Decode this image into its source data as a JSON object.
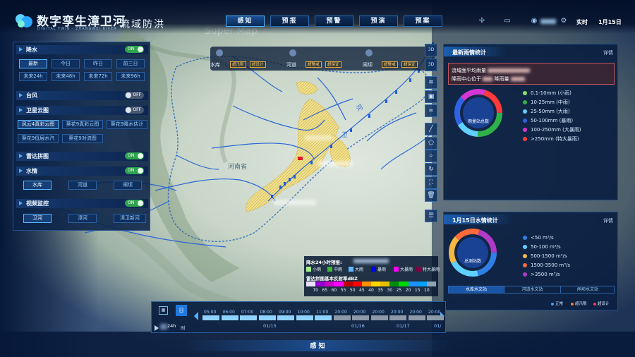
{
  "header": {
    "logo_title": "数字孪生漳卫河",
    "logo_subtitle": "DIGITAL TWIN · ZHANGWEI RIVER",
    "system_title": "流域防洪",
    "nav_tabs": [
      "感知",
      "预报",
      "预警",
      "预演",
      "预案"
    ],
    "active_tab": "感知",
    "realtime_label": "实时",
    "date": "1月15日"
  },
  "left_panel": {
    "rain": {
      "label": "降水",
      "toggle": "ON",
      "buttons_row1": [
        "最新",
        "今日",
        "昨日",
        "前三日"
      ],
      "buttons_row2": [
        "未来24h",
        "未来48h",
        "未来72h",
        "未来96h"
      ],
      "selected": "最新"
    },
    "typhoon": {
      "label": "台风",
      "toggle": "OFF"
    },
    "satellite": {
      "label": "卫星云图",
      "toggle": "OFF",
      "buttons_row1": [
        "风云4真彩云图",
        "葵花9真彩云图",
        "葵花9降水估计"
      ],
      "buttons_row2": [
        "葵花9低层水汽",
        "葵花9对流图"
      ],
      "selected": "风云4真彩云图"
    },
    "radar": {
      "label": "雷达拼图",
      "toggle": "ON"
    },
    "water": {
      "label": "水情",
      "toggle": "ON",
      "buttons": [
        "水库",
        "河道",
        "闸坝"
      ],
      "selected": "水库"
    },
    "video": {
      "label": "视频监控",
      "toggle": "ON",
      "buttons": [
        "卫河",
        "漳河",
        "漳卫新河"
      ],
      "selected": "卫河"
    }
  },
  "map": {
    "province_label": "河南省",
    "river_label_1": "河",
    "river_label_2": "卫",
    "legend_bar": {
      "groups": [
        {
          "name": "水库",
          "badges": [
            "超汛限",
            "超设计"
          ]
        },
        {
          "name": "河道",
          "badges": [
            "超警戒",
            "超保证"
          ]
        },
        {
          "name": "闸坝",
          "badges": [
            "超警戒",
            "超保证"
          ]
        }
      ]
    },
    "rain_legend": {
      "title": "降水24小时预报:",
      "items": [
        "小雨",
        "中雨",
        "大雨",
        "暴雨",
        "大暴雨",
        "特大暴雨"
      ],
      "item_colors": [
        "#a6f28f",
        "#3db83d",
        "#61b8ff",
        "#0000fe",
        "#fa00fa",
        "#800040"
      ],
      "radar_title": "雷达拼图基本反射率dBZ",
      "scale": [
        "70",
        "65",
        "60",
        "55",
        "50",
        "45",
        "40",
        "35",
        "30",
        "25",
        "20",
        "15",
        "10"
      ],
      "scale_colors": [
        "#e9e1ff",
        "#9400d3",
        "#c800c8",
        "#ff00ff",
        "#c00000",
        "#ff0000",
        "#ff9000",
        "#ffd800",
        "#e7c000",
        "#008e00",
        "#00d800",
        "#1e90ff",
        "#01a0f6",
        "#8fa3b6"
      ]
    }
  },
  "toolbar": {
    "icons": [
      "3D",
      "3D",
      "layers-icon",
      "image-icon",
      "link-icon",
      "ruler-icon",
      "polygon-icon",
      "search-icon",
      "refresh-icon",
      "fit-icon",
      "delete-icon",
      "list-icon"
    ]
  },
  "rain_stats": {
    "title": "最新雨情统计",
    "more": "详情",
    "info_line1": "流域面平均雨量",
    "info_line2": "降雨中心位于",
    "info_line2_suffix": "降雨量",
    "donut_label": "雨量站总数",
    "legend": [
      {
        "label": "0.1-10mm (小雨)",
        "color": "#8ee06a"
      },
      {
        "label": "10-25mm (中雨)",
        "color": "#2fb24a"
      },
      {
        "label": "25-50mm (大雨)",
        "color": "#5fd0ff"
      },
      {
        "label": "50-100mm (暴雨)",
        "color": "#2f63e6"
      },
      {
        "label": "100-250mm (大暴雨)",
        "color": "#d437d4"
      },
      {
        "label": ">250mm (特大暴雨)",
        "color": "#ff3a3a"
      }
    ]
  },
  "water_stats": {
    "title": "1月15日水情统计",
    "more": "详情",
    "donut_label": "总测站数",
    "legend": [
      {
        "label": "<50 m³/s",
        "color": "#2f7fe6"
      },
      {
        "label": "50-100 m³/s",
        "color": "#5fd0ff"
      },
      {
        "label": "500-1500 m³/s",
        "color": "#f5b840"
      },
      {
        "label": "1500-3500 m³/s",
        "color": "#ff6a3a"
      },
      {
        "label": ">3500 m³/s",
        "color": "#b03ac8"
      }
    ],
    "tabs": [
      "水库水文站",
      "河道水文站",
      "闸坝水文站"
    ],
    "active_tab": "水库水文站",
    "status": [
      "正常",
      "超汛限",
      "超设计"
    ],
    "status_colors": [
      "#3da0ff",
      "#ff7a2a",
      "#ff3a3a"
    ]
  },
  "timeline": {
    "mode_day": "日",
    "play_label": "24h",
    "unit": "时",
    "times": [
      "05:00",
      "06:00",
      "07:00",
      "08:00",
      "09:00",
      "10:00",
      "11:00",
      "20:00",
      "20:00",
      "20:00",
      "20:00",
      "20:00",
      "20:00"
    ],
    "dates": [
      "01/15",
      "01/16",
      "01/17",
      "01/"
    ],
    "active_count": 7
  },
  "footer": {
    "label": "感 知"
  }
}
